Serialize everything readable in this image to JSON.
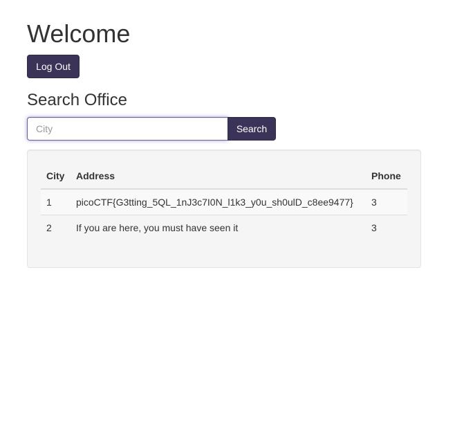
{
  "page": {
    "title": "Welcome",
    "logout_label": "Log Out"
  },
  "search": {
    "heading": "Search Office",
    "placeholder": "City",
    "value": "",
    "button_label": "Search"
  },
  "results": {
    "columns": [
      "City",
      "Address",
      "Phone"
    ],
    "rows": [
      {
        "city": "1",
        "address": "picoCTF{G3tting_5QL_1nJ3c7I0N_l1k3_y0u_sh0ulD_c8ee9477}",
        "phone": "3"
      },
      {
        "city": "2",
        "address": "If you are here, you must have seen it",
        "phone": "3"
      }
    ]
  },
  "colors": {
    "primary_button": "#3b3458",
    "well_background": "#f5f5f5",
    "input_focus_border": "#6a5fa0"
  }
}
